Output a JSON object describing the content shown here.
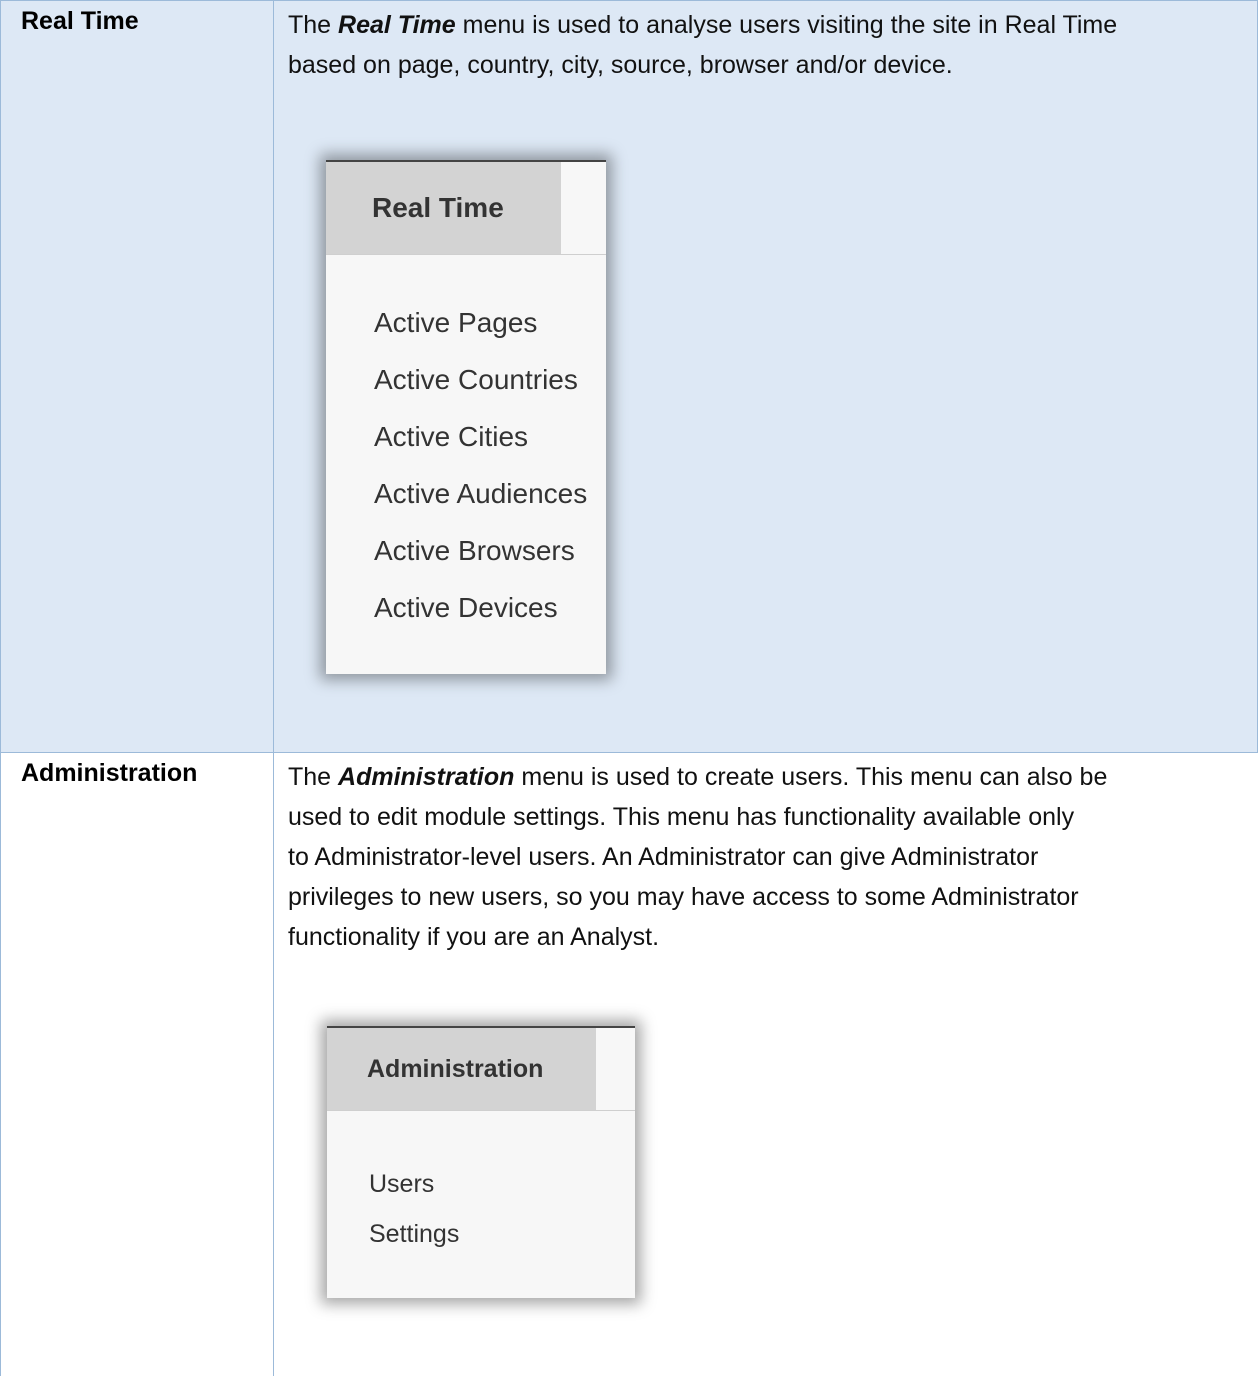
{
  "rows": [
    {
      "label": "Real Time",
      "desc_prefix": "The ",
      "desc_term": "Real Time",
      "desc_line1_rest": " menu is used to analyse users visiting the site in Real Time",
      "desc_line2": "based on page, country, city, source, browser and/or device.",
      "menu": {
        "title": "Real Time",
        "items": [
          "Active Pages",
          "Active Countries",
          "Active Cities",
          "Active Audiences",
          "Active Browsers",
          "Active Devices"
        ]
      }
    },
    {
      "label": "Administration",
      "desc_prefix": "The ",
      "desc_term": "Administration",
      "desc_line1_rest": " menu is used to create users. This menu can also be",
      "desc_lines": [
        "used to edit module settings. This menu has functionality available only",
        "to Administrator-level users. An Administrator can give Administrator",
        "privileges to new users, so you may have access to some Administrator",
        "functionality if you are an Analyst."
      ],
      "menu": {
        "title": "Administration",
        "items": [
          "Users",
          "Settings"
        ]
      }
    }
  ]
}
